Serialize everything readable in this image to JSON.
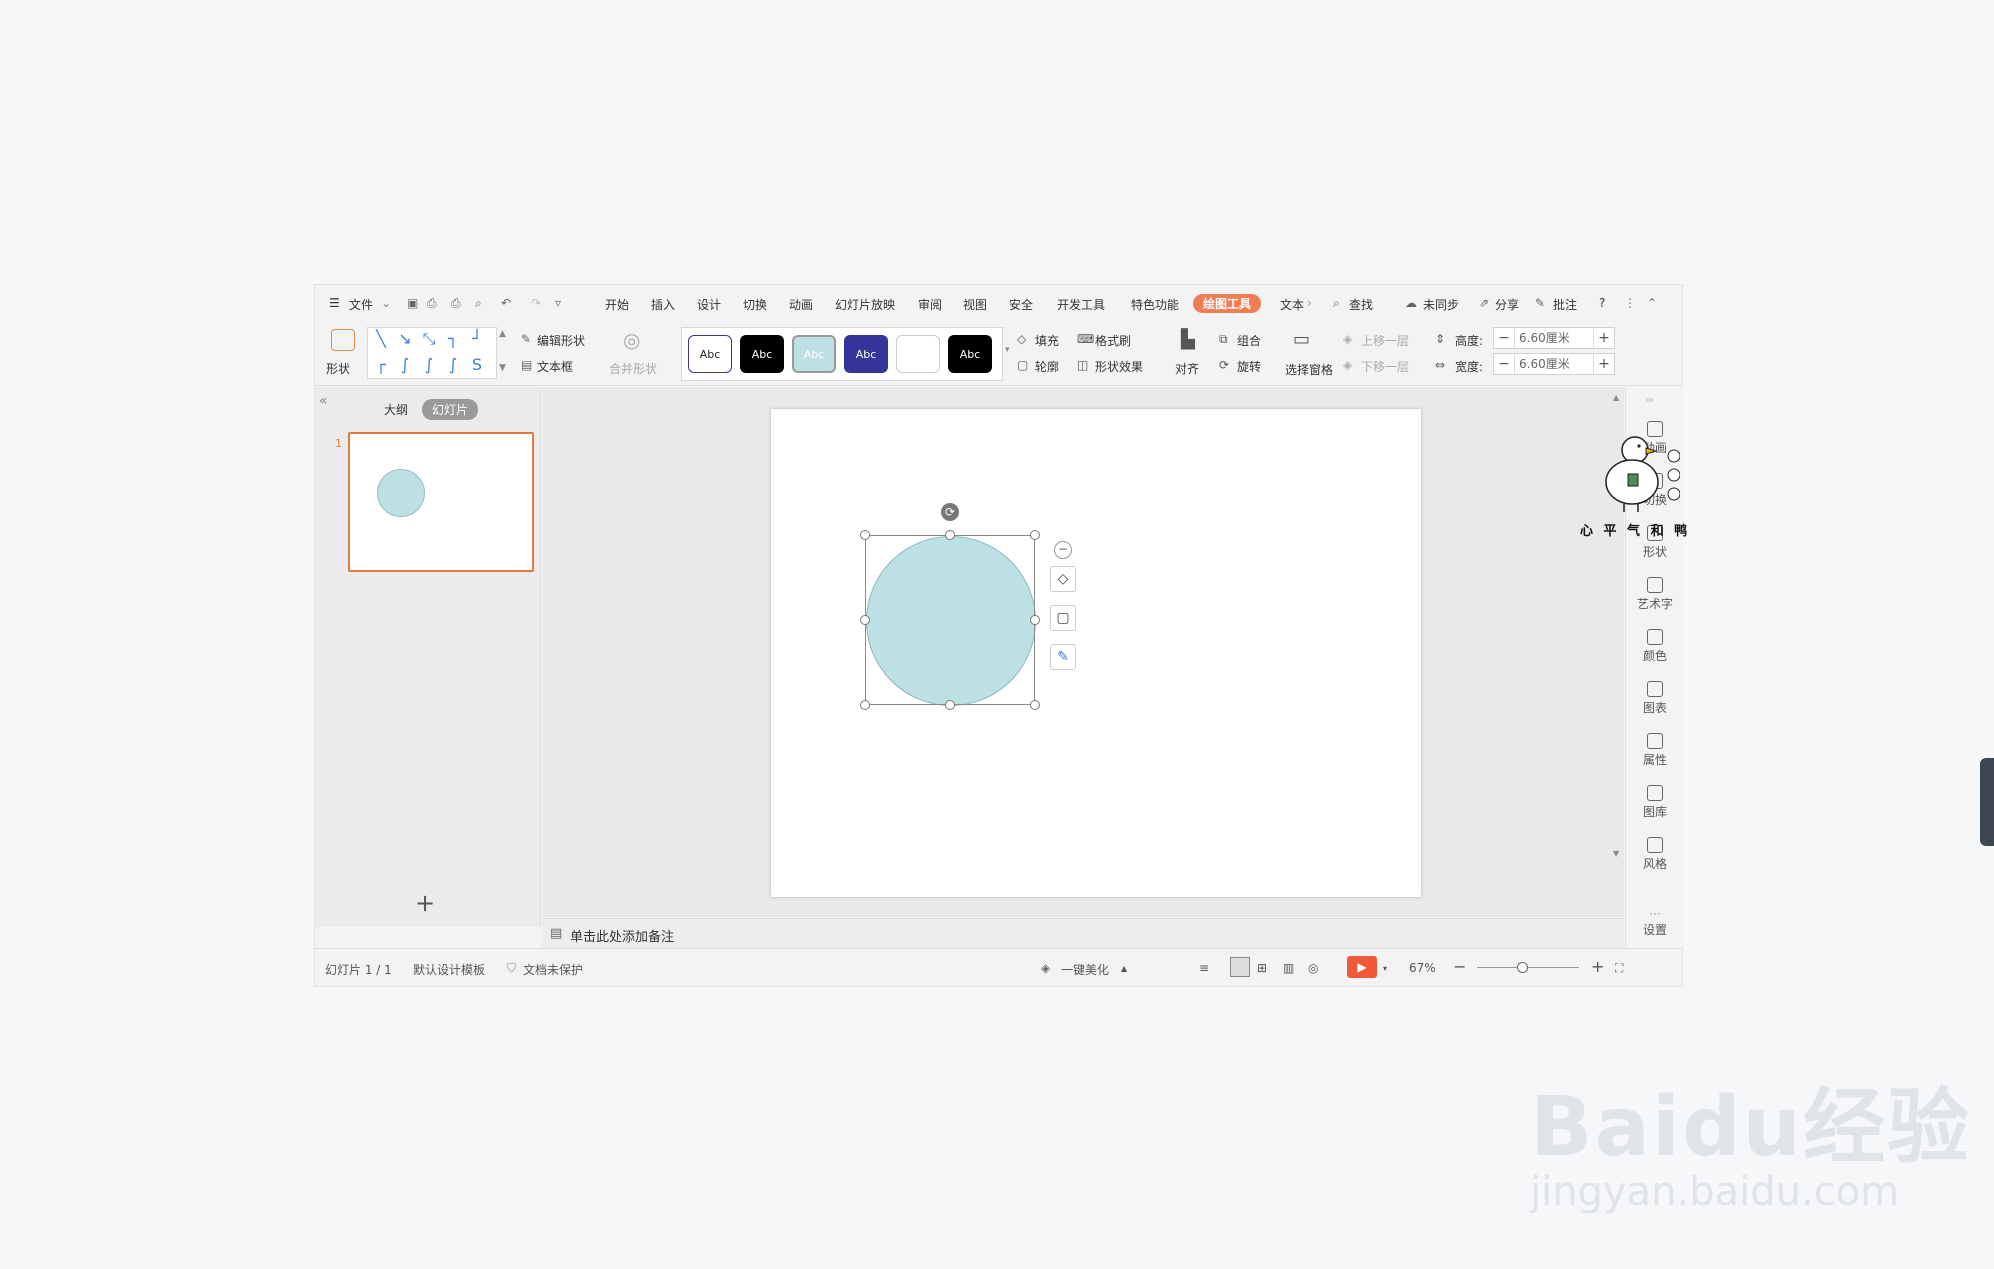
{
  "menu": {
    "file": "文件",
    "tabs": [
      "开始",
      "插入",
      "设计",
      "切换",
      "动画",
      "幻灯片放映",
      "审阅",
      "视图",
      "安全",
      "开发工具",
      "特色功能",
      "绘图工具",
      "文本"
    ],
    "active_tab": "绘图工具",
    "search": "查找",
    "sync": "未同步",
    "share": "分享",
    "comment": "批注",
    "help": "?"
  },
  "ribbon": {
    "shape": "形状",
    "edit_shape": "编辑形状",
    "text_box": "文本框",
    "merge_shape": "合并形状",
    "style_labels": [
      "Abc",
      "Abc",
      "Abc",
      "Abc",
      "",
      "Abc"
    ],
    "fill": "填充",
    "format_painter": "格式刷",
    "outline": "轮廓",
    "shape_effect": "形状效果",
    "align": "对齐",
    "group": "组合",
    "rotate": "旋转",
    "selection_pane": "选择窗格",
    "bring_forward": "上移一层",
    "send_backward": "下移一层",
    "height_label": "高度:",
    "width_label": "宽度:",
    "height_value": "6.60厘米",
    "width_value": "6.60厘米"
  },
  "left_panel": {
    "outline_tab": "大纲",
    "slides_tab": "幻灯片",
    "slide_number": "1",
    "add": "+"
  },
  "notes_placeholder": "单击此处添加备注",
  "right_sidebar": [
    "动画",
    "切换",
    "形状",
    "艺术字",
    "颜色",
    "图表",
    "属性",
    "图库",
    "风格",
    "设置"
  ],
  "status": {
    "slide_info": "幻灯片 1 / 1",
    "template": "默认设计模板",
    "protection": "文档未保护",
    "beautify": "一键美化",
    "zoom": "67%"
  },
  "sticker_text": "心 平 气 和 鸭",
  "watermark": {
    "brand": "Baidu经验",
    "url": "jingyan.baidu.com"
  },
  "colors": {
    "accent": "#f07c54",
    "circle_fill": "#bce0e3",
    "thumb_border": "#e07b40",
    "play": "#f05a3a"
  }
}
